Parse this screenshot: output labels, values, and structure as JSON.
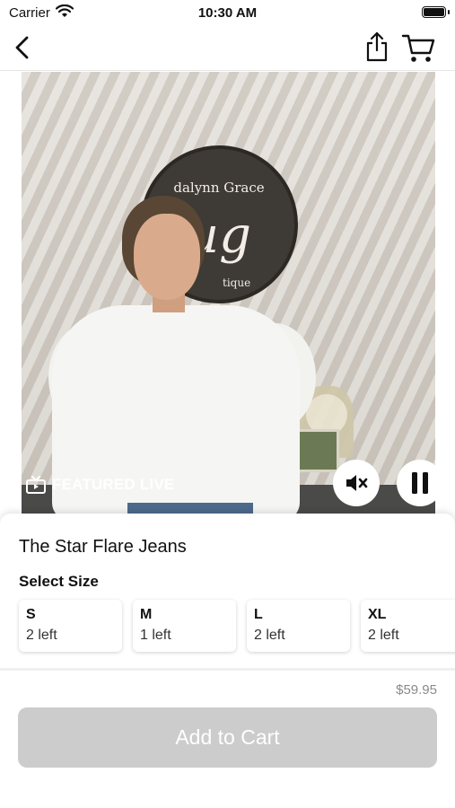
{
  "status_bar": {
    "carrier": "Carrier",
    "time": "10:30 AM"
  },
  "nav": {
    "back_icon": "chevron-left-icon",
    "share_icon": "share-icon",
    "cart_icon": "cart-icon"
  },
  "video": {
    "badge_label": "FEATURED LIVE",
    "badge_icon": "tv-icon",
    "sign_text": "dalynn Grace",
    "sign_monogram": "ug",
    "sign_sub": "tique",
    "mute_icon": "mute-icon",
    "pause_icon": "pause-icon"
  },
  "product": {
    "title": "The Star Flare Jeans",
    "select_size_label": "Select Size",
    "sizes": [
      {
        "size": "S",
        "stock": "2 left"
      },
      {
        "size": "M",
        "stock": "1 left"
      },
      {
        "size": "L",
        "stock": "2 left"
      },
      {
        "size": "XL",
        "stock": "2 left"
      }
    ],
    "price": "$59.95",
    "add_to_cart_label": "Add to Cart"
  },
  "colors": {
    "button_disabled": "#cccccc",
    "price_text": "#8a8a8a"
  }
}
